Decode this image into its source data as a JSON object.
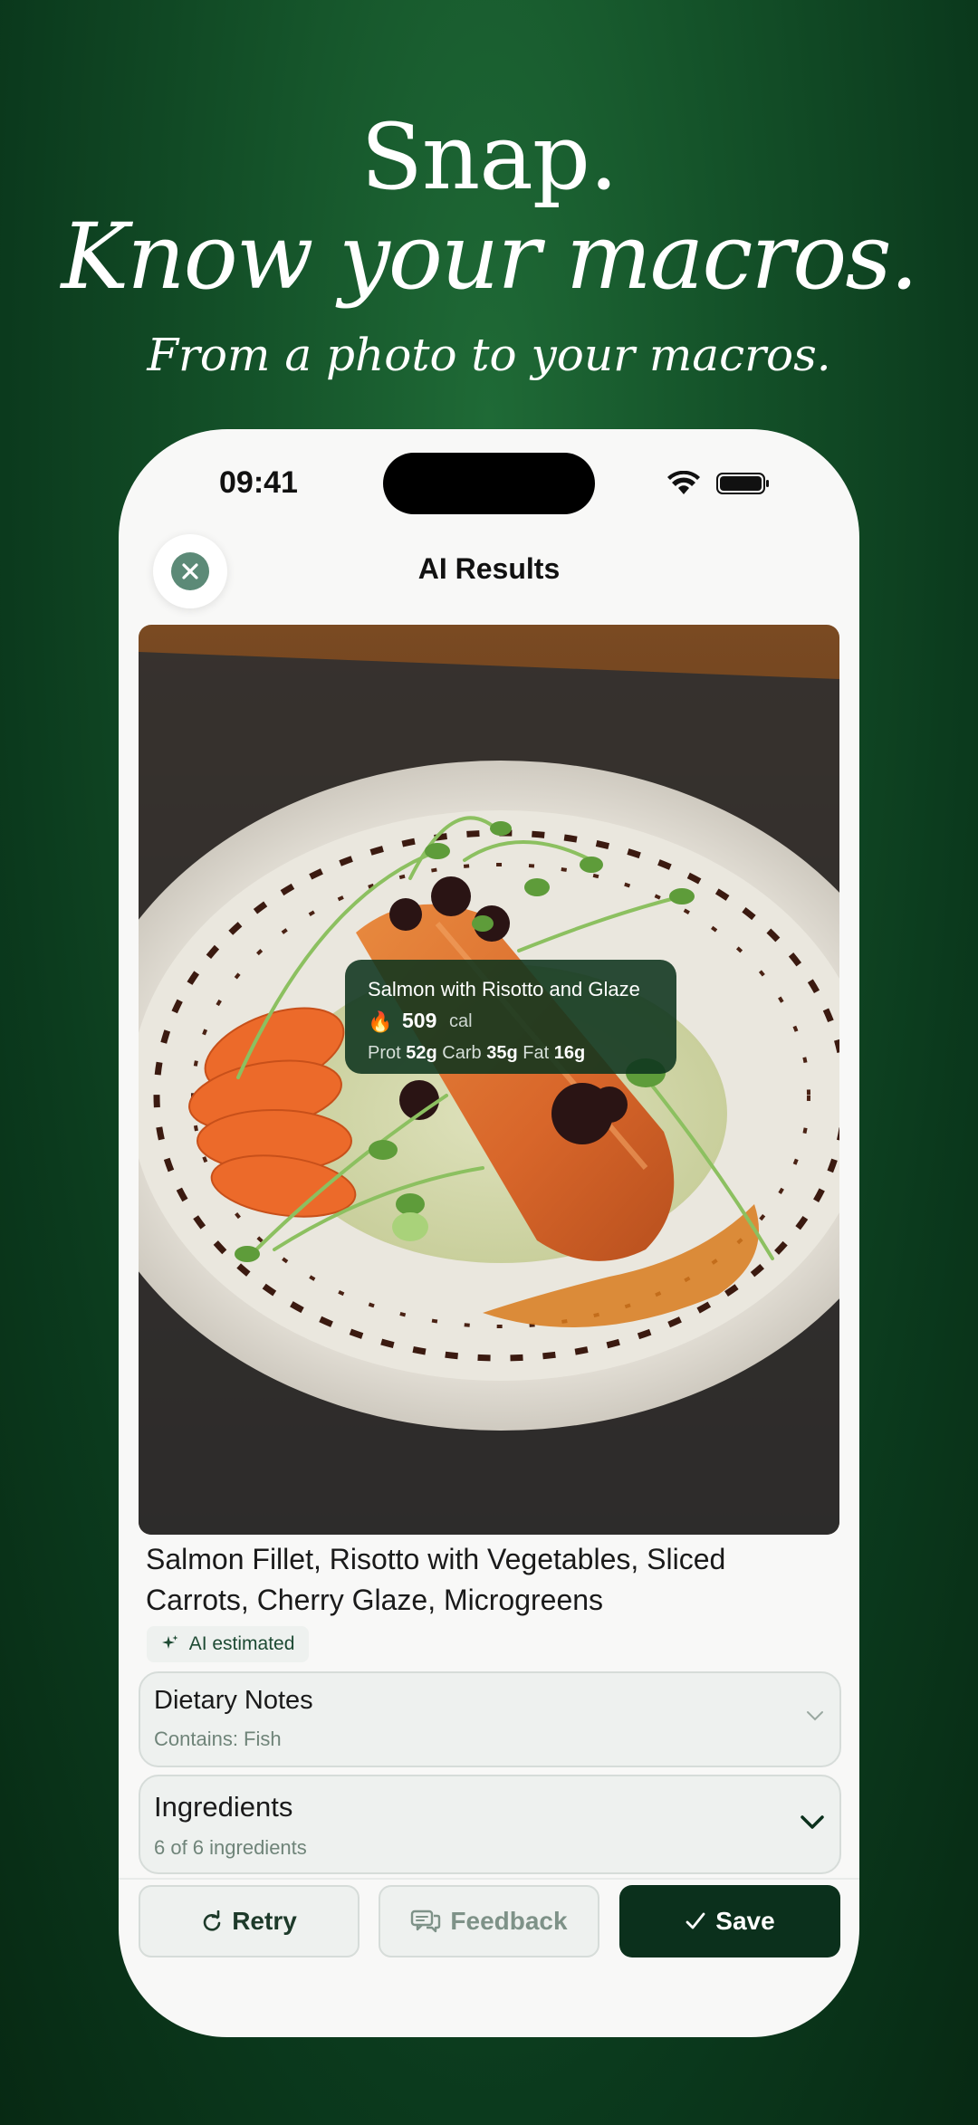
{
  "hero": {
    "line1": "Snap.",
    "line2": "Know your macros.",
    "subtitle": "From a photo to your macros."
  },
  "status_bar": {
    "time": "09:41"
  },
  "nav": {
    "title": "AI Results"
  },
  "detection": {
    "name": "Salmon with Risotto and Glaze",
    "calories": "509",
    "calories_unit": "cal",
    "prot_label": "Prot",
    "prot": "52g",
    "carb_label": "Carb",
    "carb": "35g",
    "fat_label": "Fat",
    "fat": "16g"
  },
  "dish": {
    "title": "Salmon Fillet, Risotto with Vegetables, Sliced Carrots, Cherry Glaze, Microgreens",
    "badge": "AI estimated"
  },
  "dietary": {
    "title": "Dietary Notes",
    "subtitle": "Contains: Fish"
  },
  "ingredients": {
    "title": "Ingredients",
    "subtitle": "6 of 6 ingredients"
  },
  "actions": {
    "retry": "Retry",
    "feedback": "Feedback",
    "save": "Save"
  },
  "colors": {
    "background": "#145229",
    "accent": "#0b301c",
    "card": "#eef1ef"
  }
}
